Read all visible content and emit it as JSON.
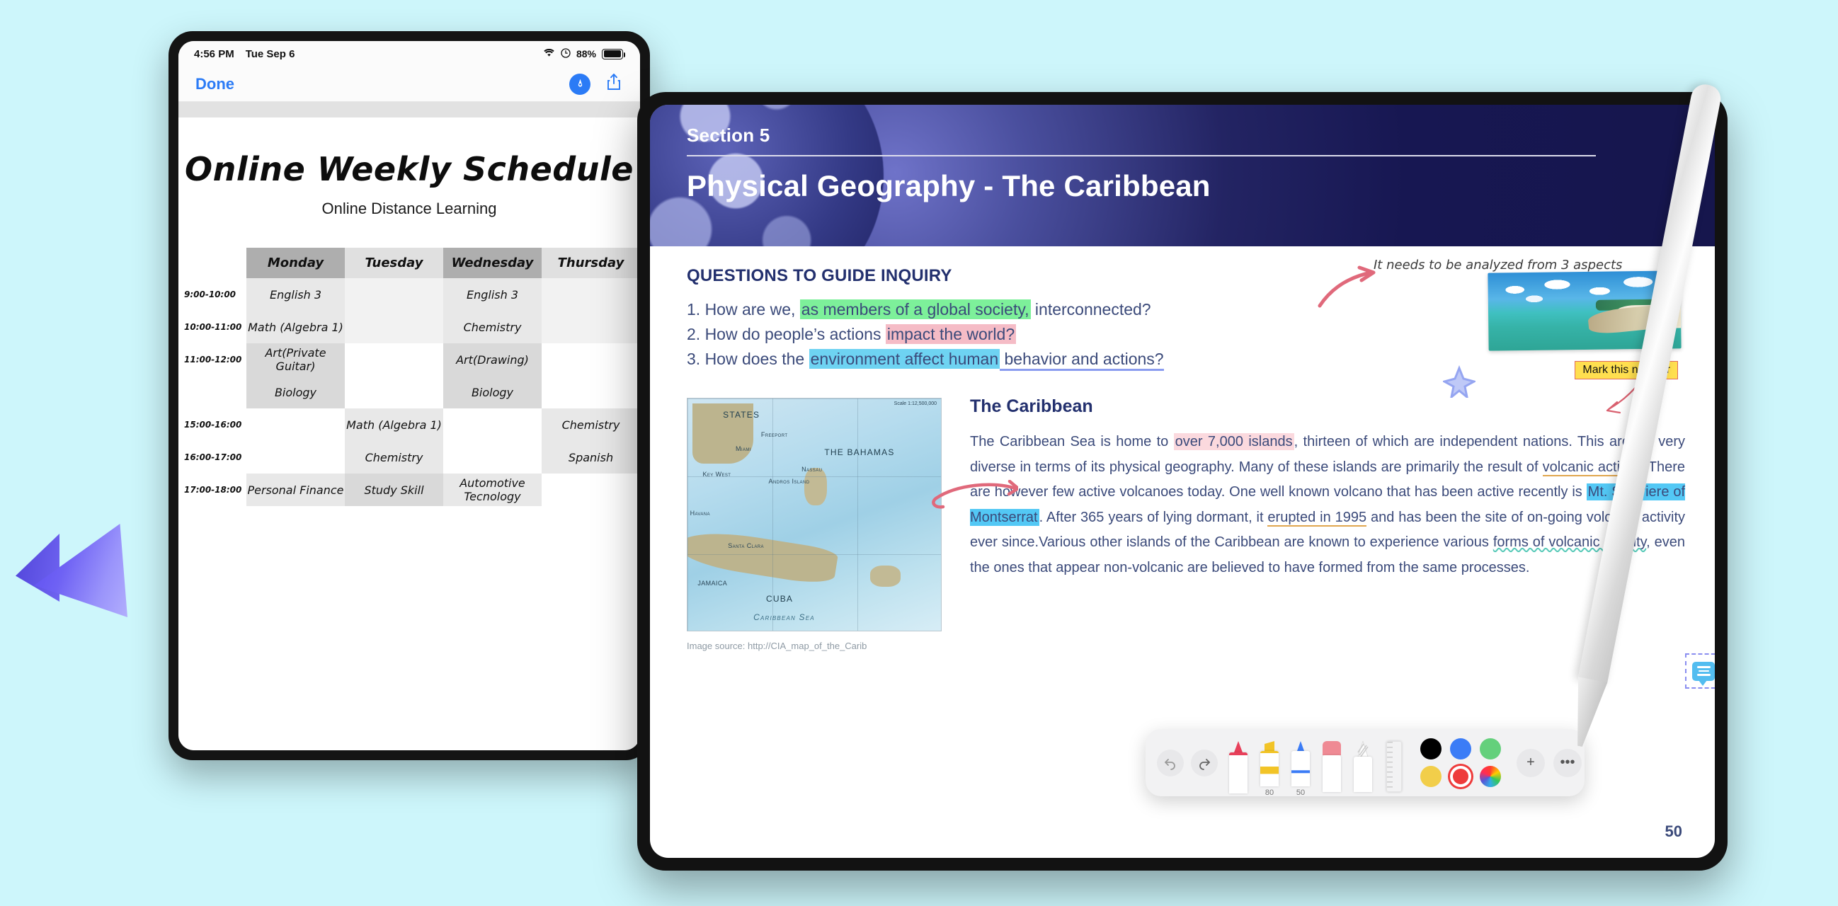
{
  "left_tablet": {
    "statusbar": {
      "time": "4:56 PM",
      "date": "Tue Sep 6",
      "wifi_icon": "wifi-icon",
      "location_icon": "location-icon",
      "battery_pct": "88%"
    },
    "navbar": {
      "done_label": "Done",
      "markup_icon": "markup-pen-icon",
      "share_icon": "share-icon"
    },
    "document": {
      "title": "Online Weekly Schedule",
      "subtitle": "Online Distance Learning",
      "days": [
        "Monday",
        "Tuesday",
        "Wednesday",
        "Thursday"
      ],
      "times": [
        "9:00-10:00",
        "10:00-11:00",
        "11:00-12:00",
        "15:00-16:00",
        "16:00-17:00",
        "17:00-18:00"
      ],
      "cells": [
        {
          "time": "9:00-10:00",
          "monday": "English 3",
          "tuesday": "",
          "wednesday": "English 3",
          "thursday": ""
        },
        {
          "time": "10:00-11:00",
          "monday": "Math (Algebra 1)",
          "tuesday": "",
          "wednesday": "Chemistry",
          "thursday": ""
        },
        {
          "time": "11:00-12:00",
          "monday": "Art(Private Guitar)",
          "tuesday": "",
          "wednesday": "Art(Drawing)",
          "thursday": ""
        },
        {
          "time": "",
          "monday": "Biology",
          "tuesday": "",
          "wednesday": "Biology",
          "thursday": ""
        },
        {
          "time": "15:00-16:00",
          "monday": "",
          "tuesday": "Math (Algebra 1)",
          "wednesday": "",
          "thursday": "Chemistry"
        },
        {
          "time": "16:00-17:00",
          "monday": "",
          "tuesday": "Chemistry",
          "wednesday": "",
          "thursday": "Spanish"
        },
        {
          "time": "17:00-18:00",
          "monday": "Personal Finance",
          "tuesday": "Study Skill",
          "wednesday": "Automotive Tecnology",
          "thursday": ""
        }
      ]
    }
  },
  "right_tablet": {
    "slide": {
      "section": "Section 5",
      "title": "Physical Geography - The Caribbean",
      "questions_heading": "QUESTIONS TO GUIDE INQUIRY",
      "q1": {
        "pre": "1. How are we, ",
        "hl": "as members of a global society,",
        "post": " interconnected?"
      },
      "q2": {
        "pre": "2. How do people’s actions ",
        "hl": "impact the world?",
        "post": ""
      },
      "q3": {
        "pre": "3. How does the ",
        "hl": "environment affect human",
        "post": " behavior and actions?"
      },
      "article_heading": "The Caribbean",
      "article": {
        "s1": "The Caribbean Sea is home to ",
        "hl1": "over 7,000 islands",
        "s2": ", thirteen of which are independent nations. This area is very diverse in terms of its physical geography. Many of these islands are primarily the result of ",
        "u1": "volcanic activity",
        "s3": ". There are however few active volcanoes today. One well known volcano that has been active recently is ",
        "hl2": "Mt. Soufriere of Montserrat",
        "s4": ". After 365 years of lying dormant, it ",
        "u2": "erupted in 1995",
        "s5": " and has been the site of on-going volcanic activity ever since.Various other islands of the Caribbean are known to experience various ",
        "u3": "forms of volcanic activity",
        "s6": ", even the ones that appear non-volcanic are believed to have formed from the same processes."
      },
      "image_source": "Image source: http://CIA_map_of_the_Carib",
      "page_number": "50",
      "map_labels": {
        "states": "STATES",
        "bahamas": "THE BAHAMAS",
        "cuba": "CUBA",
        "nassau": "Nassau",
        "miami": "Miami",
        "keywest": "Key West",
        "freeport": "Freeport",
        "andros": "Andros Island",
        "havana": "Havana",
        "santaclara": "Santa Clara",
        "jamaica": "JAMAICA",
        "caribbeansea": "Caribbean Sea",
        "scale": "Scale 1:12,500,000"
      }
    },
    "annotations": {
      "note_top": "It needs to be analyzed from 3 aspects",
      "mark_number": "Mark this number",
      "comment_icon": "comment-bubble-icon"
    },
    "pen_toolbar": {
      "undo_icon": "undo-icon",
      "redo_icon": "redo-icon",
      "tools": [
        {
          "name": "red-pen",
          "tip_color": "#e8405a",
          "size": ""
        },
        {
          "name": "yellow-highlighter",
          "tip_color": "#f2c427",
          "size": "80"
        },
        {
          "name": "blue-pen",
          "tip_color": "#3b7cf6",
          "size": "50"
        },
        {
          "name": "eraser",
          "tip_color": "#ef8a94",
          "size": ""
        },
        {
          "name": "pencil",
          "tip_color": "#d7d7d7",
          "size": ""
        },
        {
          "name": "ruler",
          "tip_color": "#ffffff",
          "size": ""
        }
      ],
      "colors": [
        {
          "name": "black",
          "hex": "#000000",
          "selected": false
        },
        {
          "name": "blue",
          "hex": "#3b7cf6",
          "selected": false
        },
        {
          "name": "green",
          "hex": "#64d07c",
          "selected": false
        },
        {
          "name": "yellow",
          "hex": "#f2ce4a",
          "selected": false
        },
        {
          "name": "red",
          "hex": "#ee3b3b",
          "selected": true
        },
        {
          "name": "color-wheel",
          "hex": "rainbow",
          "selected": false
        }
      ],
      "add_label": "+",
      "more_label": "•••"
    }
  },
  "colors": {
    "page_bg": "#cdf6fb",
    "slide_navy": "#1b1c58",
    "heading_blue": "#23306e",
    "body_blue": "#3b4a7a",
    "ios_blue": "#2b7bf6",
    "hl_green": "#7df09a",
    "hl_pink": "#f5bcc6",
    "hl_blue": "#6ed3f2",
    "annotation_red": "#e0697b",
    "mark_yellow": "#ffdf4f"
  }
}
